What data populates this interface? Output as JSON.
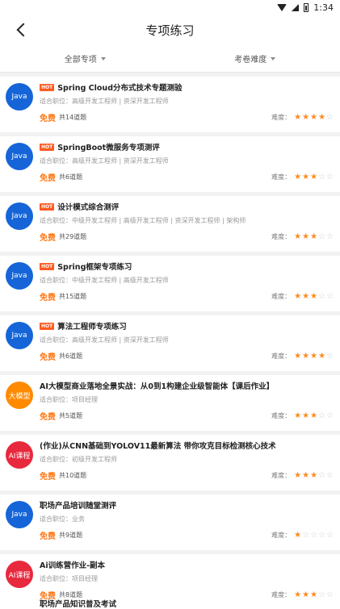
{
  "status": {
    "time": "1:34"
  },
  "header": {
    "title": "专项练习"
  },
  "filters": [
    {
      "label": "全部专项"
    },
    {
      "label": "考卷难度"
    }
  ],
  "colors": {
    "java": "#1565d8",
    "bigmodel": "#ff8a00",
    "ai": "#e8283d",
    "free": "#ff7a1a",
    "star": "#ff8a1a"
  },
  "hot_label": "HOT",
  "difficulty_label": "难度：",
  "items": [
    {
      "avatar": "Java",
      "avatar_color": "#1565d8",
      "hot": true,
      "title": "Spring Cloud分布式技术专题测验",
      "suit": "适合职位：高级开发工程师 | 资深开发工程师",
      "free": "免费",
      "count": "共14道题",
      "stars": 4
    },
    {
      "avatar": "Java",
      "avatar_color": "#1565d8",
      "hot": true,
      "title": "SpringBoot微服务专项测评",
      "suit": "适合职位：高级开发工程师 | 资深开发工程师",
      "free": "免费",
      "count": "共6道题",
      "stars": 3
    },
    {
      "avatar": "Java",
      "avatar_color": "#1565d8",
      "hot": true,
      "title": "设计模式综合测评",
      "suit": "适合职位：中级开发工程师 | 高级开发工程师 | 资深开发工程师 | 架构师",
      "free": "免费",
      "count": "共29道题",
      "stars": 3
    },
    {
      "avatar": "Java",
      "avatar_color": "#1565d8",
      "hot": true,
      "title": "Spring框架专项练习",
      "suit": "适合职位：中级开发工程师 | 高级开发工程师",
      "free": "免费",
      "count": "共15道题",
      "stars": 3
    },
    {
      "avatar": "Java",
      "avatar_color": "#1565d8",
      "hot": true,
      "title": "算法工程师专项练习",
      "suit": "适合职位：高级开发工程师 | 资深开发工程师",
      "free": "免费",
      "count": "共6道题",
      "stars": 4
    },
    {
      "avatar": "大模型",
      "avatar_color": "#ff8a00",
      "hot": false,
      "title": "AI大模型商业落地全景实战：从0到1构建企业级智能体【课后作业】",
      "suit": "适合职位：项目经理",
      "free": "免费",
      "count": "共5道题",
      "stars": 3
    },
    {
      "avatar": "AI课程",
      "avatar_color": "#e8283d",
      "hot": false,
      "title": "(作业)从CNN基础到YOLOV11最新算法 带你攻克目标检测核心技术",
      "suit": "适合职位：初级开发工程师",
      "free": "免费",
      "count": "共10道题",
      "stars": 3
    },
    {
      "avatar": "Java",
      "avatar_color": "#1565d8",
      "hot": false,
      "title": "职场产品培训随堂测评",
      "suit": "适合职位：业务",
      "free": "免费",
      "count": "共9道题",
      "stars": 1
    },
    {
      "avatar": "AI课程",
      "avatar_color": "#e8283d",
      "hot": false,
      "title": "Ai训练营作业-副本",
      "suit": "适合职位：项目经理",
      "free": "免费",
      "count": "共8道题",
      "stars": 3
    }
  ],
  "partial_item": {
    "title": "职场产品知识普及考试"
  }
}
